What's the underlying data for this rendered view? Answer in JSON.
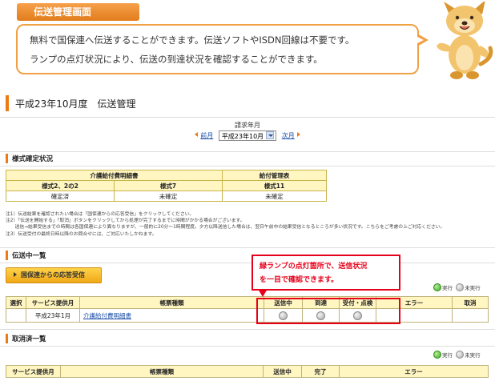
{
  "banner": {
    "tab_label": "伝送管理画面",
    "line1": "無料で国保連へ伝送することができます。伝送ソフトやISDN回線は不要です。",
    "line2": "ランプの点灯状況により、伝送の到達状況を確認することができます。"
  },
  "page_title": "平成23年10月度　伝送管理",
  "month_nav": {
    "label": "請求年月",
    "prev": "前月",
    "selected": "平成23年10月",
    "next": "次月"
  },
  "form_status": {
    "heading": "様式確定状況",
    "group1": "介護給付費明細書",
    "group2": "給付管理表",
    "cols": [
      "様式2、2の2",
      "様式7",
      "様式11"
    ],
    "values": [
      "確定済",
      "未確定",
      "未確定"
    ]
  },
  "notes": [
    "注1）伝送結果を確認されたい場合は「国保連からの応答受信」をクリックしてください。",
    "注2）「伝送を開始する」「取消」ボタンをクリックしてから処理が完了するまでに時間がかかる場合がございます。",
    "　　送信→結果受信までの時間は各国保連により異なりますが、一般的に20分～1時間程度。夕方以降送信した場合は、翌日午前中の結果受信となるところが多い状況です。こちらをご考慮の上ご対応ください。",
    "注3）伝送受付の最終日時以降のお問合せには、ご対応いたしかねます。"
  ],
  "sending": {
    "heading": "伝送中一覧",
    "receive_button": "国保連からの応答受信",
    "legend_done": "実行",
    "legend_undone": "未実行",
    "columns": [
      "選択",
      "サービス提供月",
      "帳票種類",
      "送信中",
      "到達",
      "受付・点検",
      "エラー",
      "取消"
    ],
    "rows": [
      {
        "month": "平成23年1月",
        "form": "介護給付費明細書"
      }
    ]
  },
  "callout": {
    "line1": "緑ランプの点灯箇所で、送信状況",
    "line2": "を一目で確認できます。"
  },
  "cancelled": {
    "heading": "取消済一覧",
    "legend_done": "実行",
    "legend_undone": "未実行",
    "columns": [
      "サービス提供月",
      "帳票種類",
      "送信中",
      "完了",
      "エラー"
    ]
  },
  "colors": {
    "accent_orange": "#ee7a12",
    "table_header_yellow": "#fff6c2",
    "callout_red": "#e6001a",
    "lamp_green": "#3da51e",
    "link_blue": "#1a4ea8"
  }
}
